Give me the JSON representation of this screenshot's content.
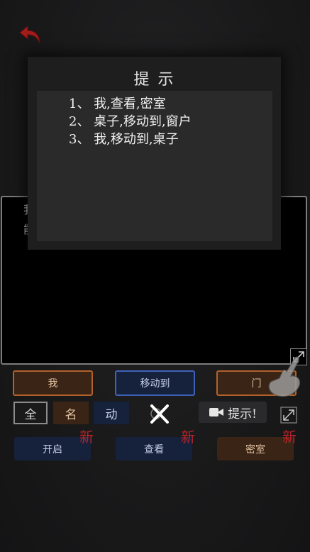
{
  "hint_modal": {
    "title": "提示",
    "lines": [
      "1、 我,查看,密室",
      "2、 桌子,移动到,窗户",
      "3、 我,移动到,桌子"
    ]
  },
  "story": {
    "lines": [
      "我",
      "能"
    ]
  },
  "word_row1": [
    {
      "label": "我",
      "color": "brown"
    },
    {
      "label": "移动到",
      "color": "blue"
    },
    {
      "label": "门",
      "color": "brown"
    }
  ],
  "filters": {
    "all": "全",
    "noun": "名",
    "verb": "动"
  },
  "hint_button": {
    "label": "提示!"
  },
  "word_row2": [
    {
      "label": "开启",
      "color": "blue",
      "badge": "新"
    },
    {
      "label": "查看",
      "color": "blue",
      "badge": "新"
    },
    {
      "label": "密室",
      "color": "brown",
      "badge": "新"
    }
  ],
  "colors": {
    "brown_border": "#b3612b",
    "blue_border": "#3f62b8",
    "badge_red": "#b3242a",
    "back_arrow": "#a31c1c"
  },
  "icons": {
    "back": "back-arrow-icon",
    "expand": "expand-icon",
    "video": "video-camera-icon",
    "close": "close-x-icon",
    "hand": "pointing-hand-icon"
  }
}
